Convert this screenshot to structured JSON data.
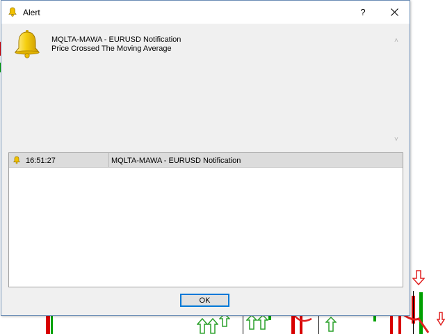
{
  "window": {
    "title": "Alert",
    "help_label": "?"
  },
  "message": {
    "line1": "MQLTA-MAWA - EURUSD Notification",
    "line2": "Price Crossed The Moving Average"
  },
  "alerts": [
    {
      "time": "16:51:27",
      "message": "MQLTA-MAWA - EURUSD Notification"
    }
  ],
  "buttons": {
    "ok_label": "OK"
  },
  "colors": {
    "bell": "#f2c200",
    "border_accent": "#0078d7",
    "candle_red": "#d80000",
    "candle_green": "#00a000",
    "arrow_up": "#2aa02a",
    "arrow_down": "#e02020"
  },
  "icons": {
    "title": "bell-icon",
    "message": "bell-icon",
    "row": "bell-icon",
    "close": "close-icon"
  }
}
